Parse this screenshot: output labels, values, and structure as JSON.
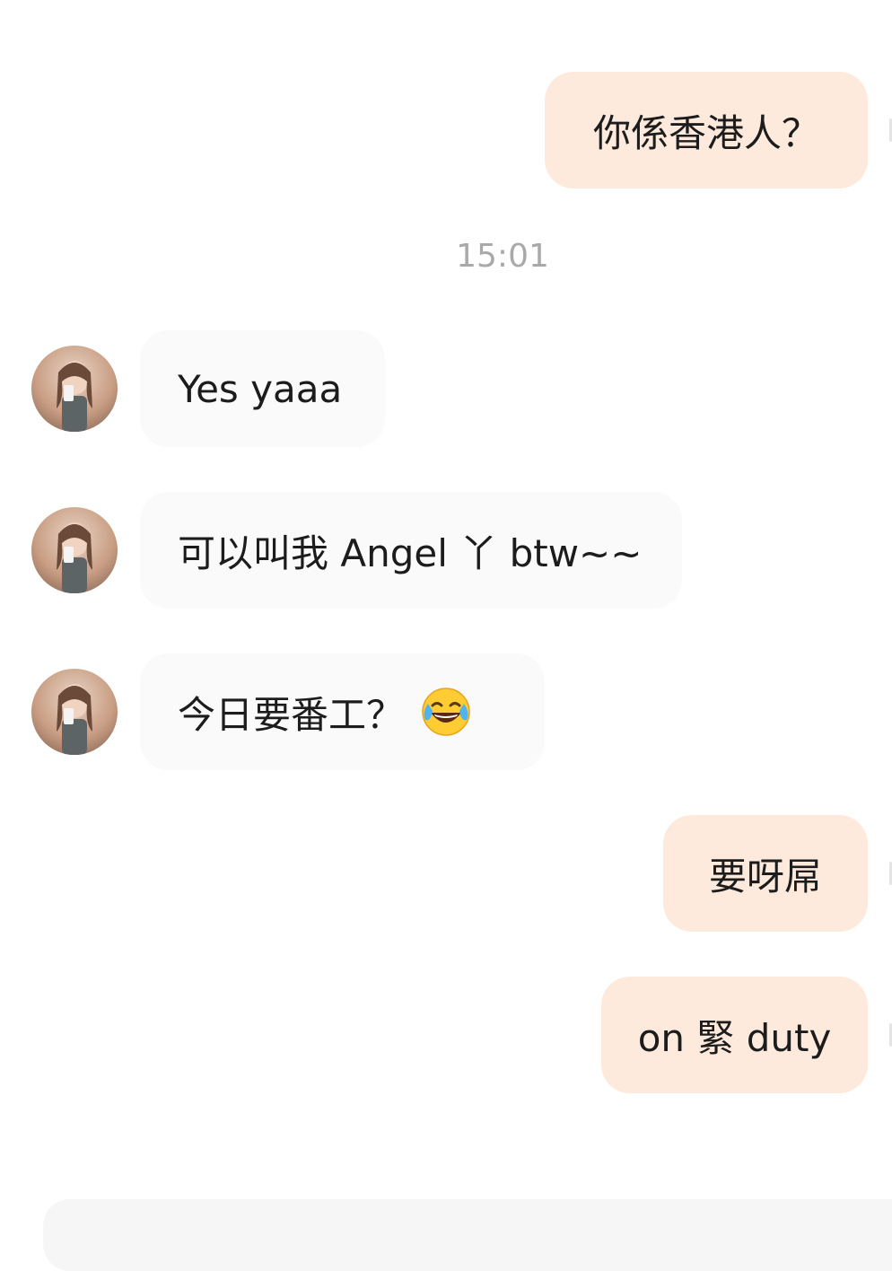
{
  "messages": {
    "m1": "你係香港人？",
    "timestamp": "15:01",
    "m2": "Yes yaaa",
    "m3": "可以叫我 Angel 丫 btw~~",
    "m4": "今日要番工？",
    "m4_emoji": "face-with-tears-of-joy-emoji",
    "m5": "要呀屌",
    "m6": "on 緊 duty"
  },
  "colors": {
    "outgoing_bubble": "#fdeadd",
    "incoming_bubble": "#fafafa",
    "timestamp": "#a9a9a9",
    "background": "#ffffff"
  }
}
